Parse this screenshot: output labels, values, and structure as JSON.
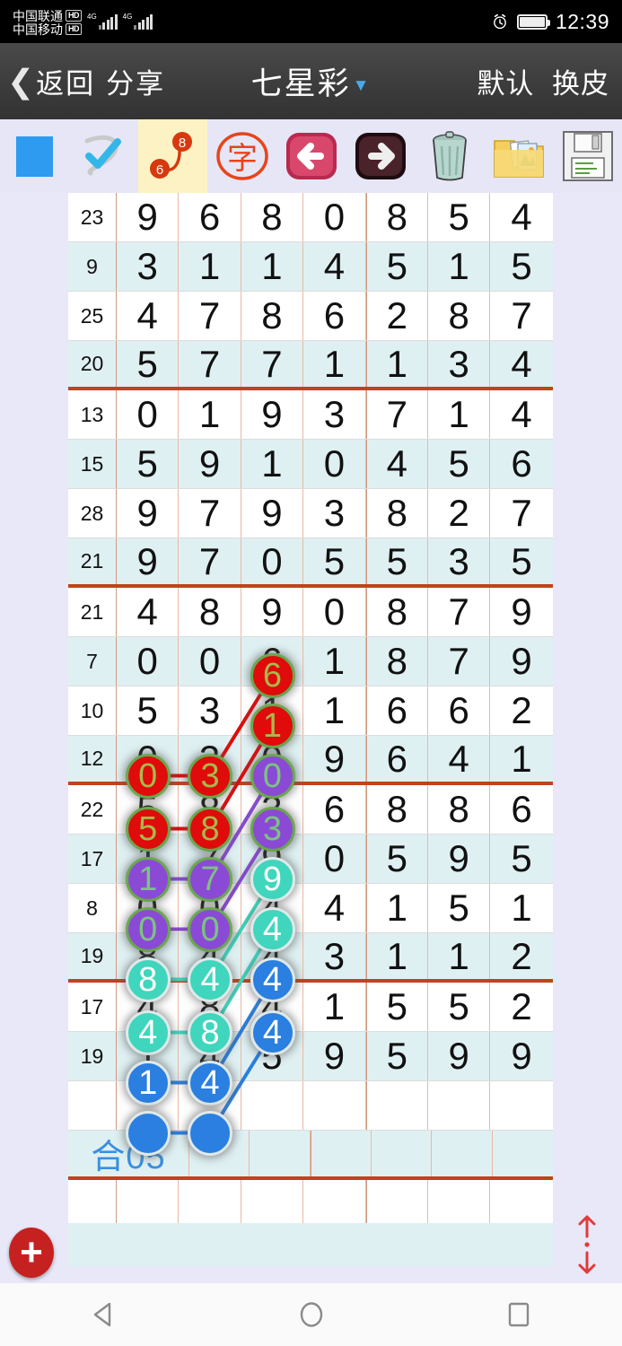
{
  "status_bar": {
    "carriers": [
      {
        "name": "中国联通",
        "badge": "HD",
        "net": "4G"
      },
      {
        "name": "中国移动",
        "badge": "HD",
        "net": "4G"
      }
    ],
    "alarm_icon": "alarm-clock-icon",
    "battery_icon": "battery-full-icon",
    "time": "12:39"
  },
  "nav": {
    "back_icon": "chevron-left-icon",
    "back_label": "返回",
    "share_label": "分享",
    "title": "七星彩",
    "title_caret_icon": "chevron-down-icon",
    "right_label_1": "默认",
    "right_label_2": "换皮"
  },
  "toolbar": {
    "items": [
      {
        "name": "color-swatch-button",
        "icon": "blue-square-icon",
        "selected": false
      },
      {
        "name": "check-select-button",
        "icon": "check-lasso-icon",
        "selected": false
      },
      {
        "name": "number-link-button",
        "icon": "number-connect-icon",
        "selected": true,
        "badge_a": "8",
        "badge_b": "6"
      },
      {
        "name": "text-mode-button",
        "icon": "chinese-zi-stamp-icon",
        "selected": false
      },
      {
        "name": "undo-button",
        "icon": "arrow-left-icon",
        "selected": false
      },
      {
        "name": "redo-button",
        "icon": "arrow-right-icon",
        "selected": false
      },
      {
        "name": "delete-button",
        "icon": "trash-can-icon",
        "selected": false
      },
      {
        "name": "gallery-button",
        "icon": "photo-folder-icon",
        "selected": false
      },
      {
        "name": "save-button",
        "icon": "floppy-disk-icon",
        "selected": false
      }
    ]
  },
  "table": {
    "col_count": 8,
    "rows": [
      {
        "sum": "23",
        "digits": [
          "9",
          "6",
          "8",
          "0",
          "8",
          "5",
          "4"
        ],
        "alt": false,
        "sep": "thin"
      },
      {
        "sum": "9",
        "digits": [
          "3",
          "1",
          "1",
          "4",
          "5",
          "1",
          "5"
        ],
        "alt": true,
        "sep": "thin"
      },
      {
        "sum": "25",
        "digits": [
          "4",
          "7",
          "8",
          "6",
          "2",
          "8",
          "7"
        ],
        "alt": false,
        "sep": "thin"
      },
      {
        "sum": "20",
        "digits": [
          "5",
          "7",
          "7",
          "1",
          "1",
          "3",
          "4"
        ],
        "alt": true,
        "sep": "thick"
      },
      {
        "sum": "13",
        "digits": [
          "0",
          "1",
          "9",
          "3",
          "7",
          "1",
          "4"
        ],
        "alt": false,
        "sep": "thin"
      },
      {
        "sum": "15",
        "digits": [
          "5",
          "9",
          "1",
          "0",
          "4",
          "5",
          "6"
        ],
        "alt": true,
        "sep": "thin"
      },
      {
        "sum": "28",
        "digits": [
          "9",
          "7",
          "9",
          "3",
          "8",
          "2",
          "7"
        ],
        "alt": false,
        "sep": "thin"
      },
      {
        "sum": "21",
        "digits": [
          "9",
          "7",
          "0",
          "5",
          "5",
          "3",
          "5"
        ],
        "alt": true,
        "sep": "thick"
      },
      {
        "sum": "21",
        "digits": [
          "4",
          "8",
          "9",
          "0",
          "8",
          "7",
          "9"
        ],
        "alt": false,
        "sep": "thin"
      },
      {
        "sum": "7",
        "digits": [
          "0",
          "0",
          "6",
          "1",
          "8",
          "7",
          "9"
        ],
        "alt": true,
        "sep": "thin"
      },
      {
        "sum": "10",
        "digits": [
          "5",
          "3",
          "1",
          "1",
          "6",
          "6",
          "2"
        ],
        "alt": false,
        "sep": "thin"
      },
      {
        "sum": "12",
        "digits": [
          "0",
          "3",
          "0",
          "9",
          "6",
          "4",
          "1"
        ],
        "alt": true,
        "sep": "thick"
      },
      {
        "sum": "22",
        "digits": [
          "5",
          "8",
          "3",
          "6",
          "8",
          "8",
          "6"
        ],
        "alt": false,
        "sep": "thin"
      },
      {
        "sum": "17",
        "digits": [
          "1",
          "7",
          "9",
          "0",
          "5",
          "9",
          "5"
        ],
        "alt": true,
        "sep": "thin"
      },
      {
        "sum": "8",
        "digits": [
          "0",
          "0",
          "4",
          "4",
          "1",
          "5",
          "1"
        ],
        "alt": false,
        "sep": "thin"
      },
      {
        "sum": "19",
        "digits": [
          "8",
          "4",
          "4",
          "3",
          "1",
          "1",
          "2"
        ],
        "alt": true,
        "sep": "thick"
      },
      {
        "sum": "17",
        "digits": [
          "4",
          "8",
          "4",
          "1",
          "5",
          "5",
          "2"
        ],
        "alt": false,
        "sep": "thin"
      },
      {
        "sum": "19",
        "digits": [
          "1",
          "4",
          "5",
          "9",
          "5",
          "9",
          "9"
        ],
        "alt": true,
        "sep": "thin"
      },
      {
        "sum": "",
        "digits": [
          "",
          "",
          "",
          "",
          "",
          "",
          ""
        ],
        "alt": false,
        "sep": "thin"
      }
    ],
    "sum_row": {
      "label": "合05",
      "alt": true,
      "sep": "thick"
    },
    "blank_row": {
      "alt": false
    }
  },
  "markers": {
    "colors": {
      "red": "#e00b0b",
      "purple": "#8b4ad6",
      "teal": "#3fd6bd",
      "blue": "#2a7fe0",
      "ring_green": "#6aa84f",
      "ring_light": "#dfe9e9"
    },
    "cells": [
      {
        "row": 9,
        "col": 2,
        "value": "6",
        "color": "red"
      },
      {
        "row": 10,
        "col": 2,
        "value": "1",
        "color": "red"
      },
      {
        "row": 11,
        "col": 0,
        "value": "0",
        "color": "red"
      },
      {
        "row": 11,
        "col": 1,
        "value": "3",
        "color": "red"
      },
      {
        "row": 11,
        "col": 2,
        "value": "0",
        "color": "purple"
      },
      {
        "row": 12,
        "col": 0,
        "value": "5",
        "color": "red"
      },
      {
        "row": 12,
        "col": 1,
        "value": "8",
        "color": "red"
      },
      {
        "row": 12,
        "col": 2,
        "value": "3",
        "color": "purple"
      },
      {
        "row": 13,
        "col": 0,
        "value": "1",
        "color": "purple"
      },
      {
        "row": 13,
        "col": 1,
        "value": "7",
        "color": "purple"
      },
      {
        "row": 13,
        "col": 2,
        "value": "9",
        "color": "teal"
      },
      {
        "row": 14,
        "col": 0,
        "value": "0",
        "color": "purple"
      },
      {
        "row": 14,
        "col": 1,
        "value": "0",
        "color": "purple"
      },
      {
        "row": 14,
        "col": 2,
        "value": "4",
        "color": "teal"
      },
      {
        "row": 15,
        "col": 0,
        "value": "8",
        "color": "teal"
      },
      {
        "row": 15,
        "col": 1,
        "value": "4",
        "color": "teal"
      },
      {
        "row": 15,
        "col": 2,
        "value": "4",
        "color": "blue"
      },
      {
        "row": 16,
        "col": 0,
        "value": "4",
        "color": "teal"
      },
      {
        "row": 16,
        "col": 1,
        "value": "8",
        "color": "teal"
      },
      {
        "row": 16,
        "col": 2,
        "value": "4",
        "color": "blue"
      },
      {
        "row": 17,
        "col": 0,
        "value": "1",
        "color": "blue"
      },
      {
        "row": 17,
        "col": 1,
        "value": "4",
        "color": "blue"
      },
      {
        "row": 18,
        "col": 0,
        "value": "",
        "color": "blue"
      },
      {
        "row": 18,
        "col": 1,
        "value": "",
        "color": "blue"
      }
    ],
    "links": [
      {
        "from": [
          11,
          0
        ],
        "to": [
          11,
          1
        ],
        "color": "red"
      },
      {
        "from": [
          12,
          0
        ],
        "to": [
          12,
          1
        ],
        "color": "red"
      },
      {
        "from": [
          13,
          0
        ],
        "to": [
          13,
          1
        ],
        "color": "purple"
      },
      {
        "from": [
          14,
          0
        ],
        "to": [
          14,
          1
        ],
        "color": "purple"
      },
      {
        "from": [
          15,
          0
        ],
        "to": [
          15,
          1
        ],
        "color": "teal"
      },
      {
        "from": [
          16,
          0
        ],
        "to": [
          16,
          1
        ],
        "color": "teal"
      },
      {
        "from": [
          17,
          0
        ],
        "to": [
          17,
          1
        ],
        "color": "blue"
      },
      {
        "from": [
          18,
          0
        ],
        "to": [
          18,
          1
        ],
        "color": "blue"
      },
      {
        "from": [
          11,
          1
        ],
        "to": [
          9,
          2
        ],
        "color": "red"
      },
      {
        "from": [
          12,
          1
        ],
        "to": [
          10,
          2
        ],
        "color": "red"
      },
      {
        "from": [
          13,
          1
        ],
        "to": [
          11,
          2
        ],
        "color": "purple"
      },
      {
        "from": [
          14,
          1
        ],
        "to": [
          12,
          2
        ],
        "color": "purple"
      },
      {
        "from": [
          15,
          1
        ],
        "to": [
          13,
          2
        ],
        "color": "teal"
      },
      {
        "from": [
          16,
          1
        ],
        "to": [
          14,
          2
        ],
        "color": "teal"
      },
      {
        "from": [
          17,
          1
        ],
        "to": [
          15,
          2
        ],
        "color": "blue"
      },
      {
        "from": [
          18,
          1
        ],
        "to": [
          16,
          2
        ],
        "color": "blue"
      }
    ]
  },
  "bottom": {
    "add_button_icon": "plus-circle-icon",
    "scroll_control_icon": "scroll-updown-icon"
  },
  "system_nav": {
    "back_icon": "triangle-back-icon",
    "home_icon": "circle-home-icon",
    "recents_icon": "square-recents-icon"
  }
}
